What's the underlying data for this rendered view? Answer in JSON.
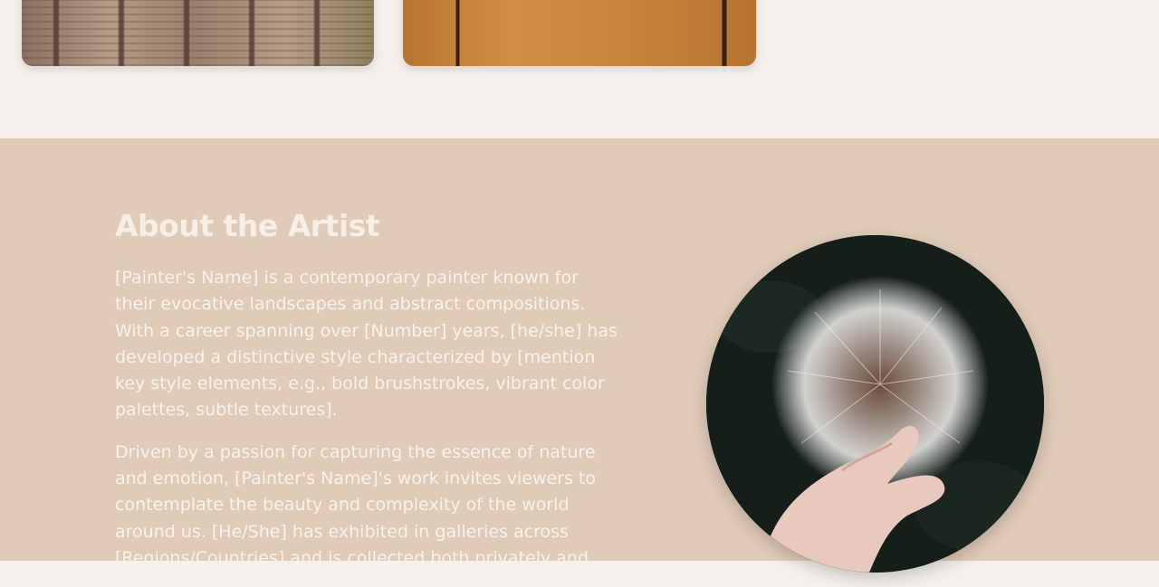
{
  "gallery": {
    "cards": [
      {
        "name": "railway-tracks-painting"
      },
      {
        "name": "wood-panel-painting"
      }
    ]
  },
  "about": {
    "title": "About the Artist",
    "paragraphs": [
      "[Painter's Name] is a contemporary painter known for their evocative landscapes and abstract compositions. With a career spanning over [Number] years, [he/she] has developed a distinctive style characterized by [mention key style elements, e.g., bold brushstrokes, vibrant color palettes, subtle textures].",
      "Driven by a passion for capturing the essence of nature and emotion, [Painter's Name]'s work invites viewers to contemplate the beauty and complexity of the world around us. [He/She] has exhibited in galleries across [Regions/Countries] and is collected both privately and"
    ],
    "image": "dandelion-in-hand-photo"
  },
  "colors": {
    "page_background": "#f5f0ec",
    "section_background": "#e0cab8",
    "text": "#f8f2ec"
  }
}
